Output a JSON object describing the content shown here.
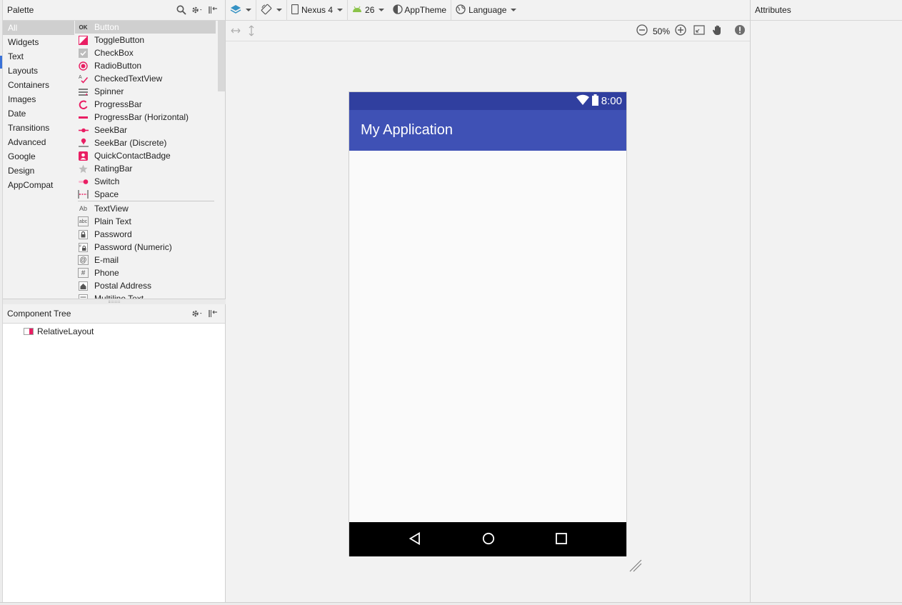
{
  "palette": {
    "title": "Palette",
    "categories": [
      "All",
      "Widgets",
      "Text",
      "Layouts",
      "Containers",
      "Images",
      "Date",
      "Transitions",
      "Advanced",
      "Google",
      "Design",
      "AppCompat"
    ],
    "widgets": [
      "Button",
      "ToggleButton",
      "CheckBox",
      "RadioButton",
      "CheckedTextView",
      "Spinner",
      "ProgressBar",
      "ProgressBar (Horizontal)",
      "SeekBar",
      "SeekBar (Discrete)",
      "QuickContactBadge",
      "RatingBar",
      "Switch",
      "Space"
    ],
    "text_items": [
      "TextView",
      "Plain Text",
      "Password",
      "Password (Numeric)",
      "E-mail",
      "Phone",
      "Postal Address",
      "Multiline Text"
    ],
    "button_icon_text": "OK",
    "textview_icon_text": "Ab",
    "plaintext_icon_text": "abc"
  },
  "component_tree": {
    "title": "Component Tree",
    "root": "RelativeLayout"
  },
  "toolbar": {
    "device": "Nexus 4",
    "api_level": "26",
    "theme": "AppTheme",
    "language": "Language"
  },
  "toolbar2": {
    "zoom": "50%"
  },
  "device_preview": {
    "time": "8:00",
    "app_title": "My Application",
    "colors": {
      "status_bar": "#303f9f",
      "app_bar": "#3f51b5",
      "nav_bar": "#000000",
      "accent": "#e91e63"
    }
  },
  "attributes": {
    "title": "Attributes"
  }
}
